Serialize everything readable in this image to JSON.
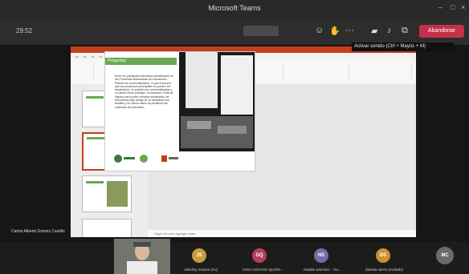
{
  "window": {
    "title": "Microsoft Teams"
  },
  "toolbar": {
    "timer": "29:52",
    "leave_label": "Abandonar",
    "tooltip": "Activar sonido (Ctrl + Mayús + M)"
  },
  "presenter": {
    "name": "Carlos Alberto Gomez Castillo"
  },
  "slide": {
    "heading": "Preguntas",
    "body": "Entre los principales afectados identificados en las Provincias amazónicas se encuentran: Pescas de comercialización, lo que involucra que sus productos principales no pueden ser trasladados, no pueden ser comercializados y no tienen cómo proteger, ni mantener. Falta de ingreso para poder comprar suministros, se encuentran bajo riesgo de no abastecer sus familias y en varios casos se perdieron las cosechas de pescados."
  },
  "notes": "Haga clic para agregar notas",
  "participants": [
    {
      "initials": "JS",
      "name": "Jaheliny Soares (Inv)",
      "color": "#c99c3a"
    },
    {
      "initials": "GQ",
      "name": "GINA CEDANO QUIÑO...",
      "color": "#b0405a"
    },
    {
      "initials": "NS",
      "name": "Natalia Sánchez - Tur...",
      "color": "#7a68a8"
    },
    {
      "initials": "DS",
      "name": "daniela sierra (Invitado)",
      "color": "#c69236"
    },
    {
      "initials": "MC",
      "name": "",
      "color": "#6b6b6b"
    }
  ]
}
